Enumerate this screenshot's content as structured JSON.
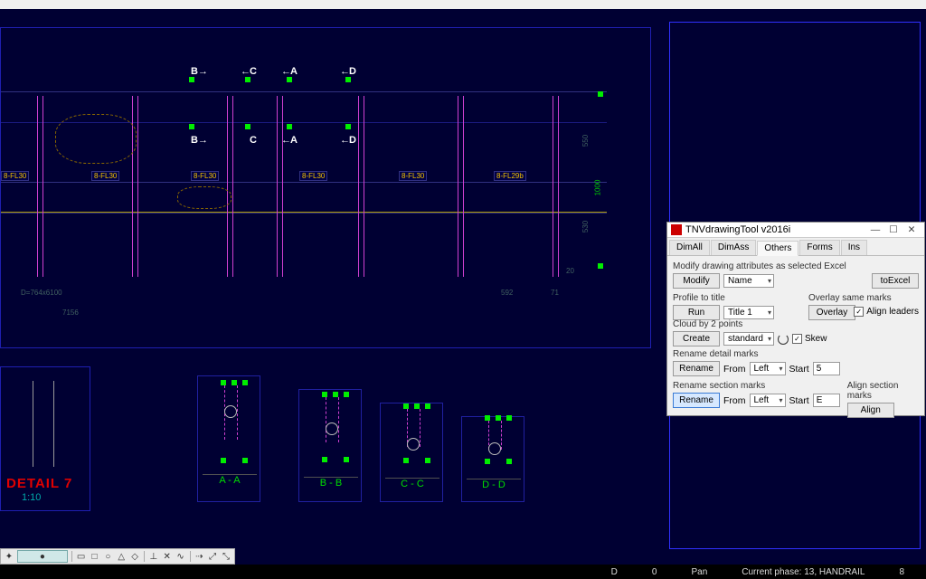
{
  "canvas": {
    "section_marks": [
      "B",
      "C",
      "A",
      "D"
    ],
    "section_marks_lower": [
      "B",
      "C",
      "A",
      "D"
    ],
    "tags": [
      "8-FL30",
      "8-FL30",
      "8-FL30",
      "8-FL30",
      "8-FL30",
      "8-FL29b"
    ],
    "dims": {
      "left_ref": "D=764x6100",
      "bottom_left": "7156",
      "bottom_mid": "592",
      "right_v1": "550",
      "right_v2": "530",
      "right_v3": "20",
      "right_small2": "71",
      "small_green": "1000"
    },
    "detail": {
      "label": "DETAIL 7",
      "scale": "1:10"
    },
    "det_labels": [
      "A - A",
      "B - B",
      "C - C",
      "D - D"
    ]
  },
  "dialog": {
    "title": "TNVdrawingTool v2016i",
    "tabs": [
      "DimAll",
      "DimAss",
      "Others",
      "Forms",
      "Ins"
    ],
    "active_tab": 2,
    "sec1_label": "Modify drawing attributes as selected Excel",
    "modify": "Modify",
    "name_sel": "Name",
    "toexcel": "toExcel",
    "sec2a": "Profile to title",
    "sec2b": "Overlay same marks",
    "run": "Run",
    "title_sel": "Title 1",
    "overlay": "Overlay",
    "align_leaders": "Align leaders",
    "sec3": "Cloud by 2 points",
    "create": "Create",
    "std_sel": "standard",
    "skew": "Skew",
    "sec4": "Rename detail marks",
    "rename": "Rename",
    "from_lbl": "From",
    "from_sel": "Left",
    "start_lbl": "Start",
    "start_val": "5",
    "sec5a": "Rename section marks",
    "sec5b": "Align section marks",
    "rename2": "Rename",
    "from_sel2": "Left",
    "start_val2": "E",
    "align": "Align"
  },
  "status": {
    "d": "D",
    "zero": "0",
    "pan": "Pan",
    "phase": "Current phase: 13, HANDRAIL",
    "right_num": "8"
  }
}
